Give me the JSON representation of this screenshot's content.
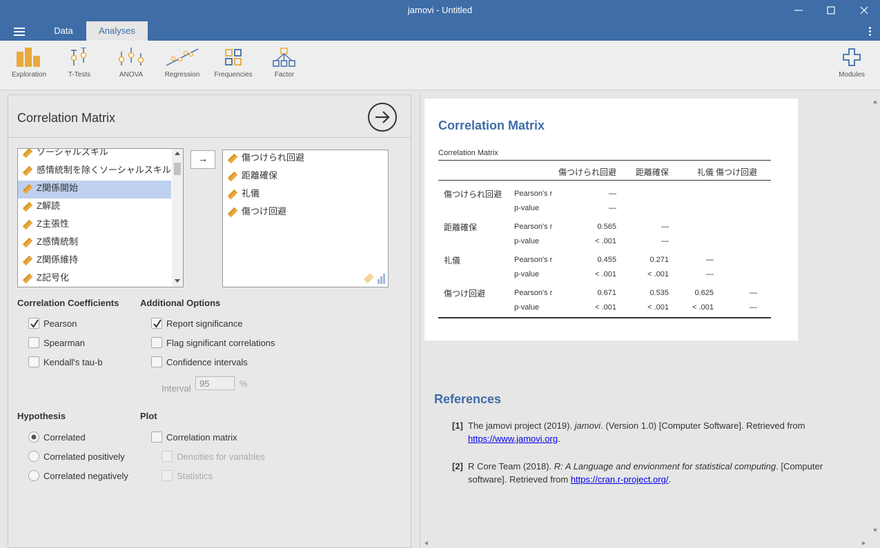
{
  "window": {
    "title": "jamovi - Untitled",
    "minimize": "—",
    "maximize": "☐",
    "close": "✕"
  },
  "tabs": {
    "data": "Data",
    "analyses": "Analyses"
  },
  "ribbon": {
    "exploration": "Exploration",
    "ttests": "T-Tests",
    "anova": "ANOVA",
    "regression": "Regression",
    "frequencies": "Frequencies",
    "factor": "Factor",
    "modules": "Modules"
  },
  "options": {
    "title": "Correlation Matrix",
    "available_vars": [
      "ソーシャルスキル",
      "感情統制を除くソーシャルスキル",
      "Z関係開始",
      "Z解読",
      "Z主張性",
      "Z感情統制",
      "Z関係維持",
      "Z記号化"
    ],
    "selected_index": 2,
    "move_arrow": "→",
    "selected_vars": [
      "傷つけられ回避",
      "距離確保",
      "礼儀",
      "傷つけ回避"
    ],
    "coefficients": {
      "heading": "Correlation Coefficients",
      "pearson": "Pearson",
      "spearman": "Spearman",
      "kendall": "Kendall's tau-b"
    },
    "additional": {
      "heading": "Additional Options",
      "report_sig": "Report significance",
      "flag_sig": "Flag significant correlations",
      "ci": "Confidence intervals",
      "interval_label": "Interval",
      "interval_value": "95",
      "interval_unit": "%"
    },
    "hypothesis": {
      "heading": "Hypothesis",
      "correlated": "Correlated",
      "positive": "Correlated positively",
      "negative": "Correlated negatively"
    },
    "plot": {
      "heading": "Plot",
      "corr_matrix": "Correlation matrix",
      "densities": "Densities for variables",
      "statistics": "Statistics"
    }
  },
  "results": {
    "title": "Correlation Matrix",
    "table_caption": "Correlation Matrix",
    "columns": [
      "傷つけられ回避",
      "距離確保",
      "礼儀",
      "傷つけ回避"
    ],
    "stat_r": "Pearson's r",
    "stat_p": "p-value",
    "rows": [
      {
        "name": "傷つけられ回避",
        "r": [
          "—",
          "",
          "",
          ""
        ],
        "p": [
          "—",
          "",
          "",
          ""
        ]
      },
      {
        "name": "距離確保",
        "r": [
          "0.565",
          "—",
          "",
          ""
        ],
        "p": [
          "< .001",
          "—",
          "",
          ""
        ]
      },
      {
        "name": "礼儀",
        "r": [
          "0.455",
          "0.271",
          "—",
          ""
        ],
        "p": [
          "< .001",
          "< .001",
          "—",
          ""
        ]
      },
      {
        "name": "傷つけ回避",
        "r": [
          "0.671",
          "0.535",
          "0.625",
          "—"
        ],
        "p": [
          "< .001",
          "< .001",
          "< .001",
          "—"
        ]
      }
    ],
    "references_title": "References",
    "ref1": {
      "num": "[1]",
      "text_a": "The jamovi project (2019). ",
      "italic": "jamovi",
      "text_b": ". (Version 1.0) [Computer Software]. Retrieved from",
      "link": "https://www.jamovi.org",
      "end": "."
    },
    "ref2": {
      "num": "[2]",
      "text_a": "R Core Team (2018). ",
      "italic": "R: A Language and envionment for statistical computing",
      "text_b": ". [Computer software]. Retrieved from ",
      "link": "https://cran.r-project.org/",
      "end": "."
    }
  },
  "colors": {
    "accent": "#3e6da8",
    "ruler_icon": "#e9a93d"
  }
}
